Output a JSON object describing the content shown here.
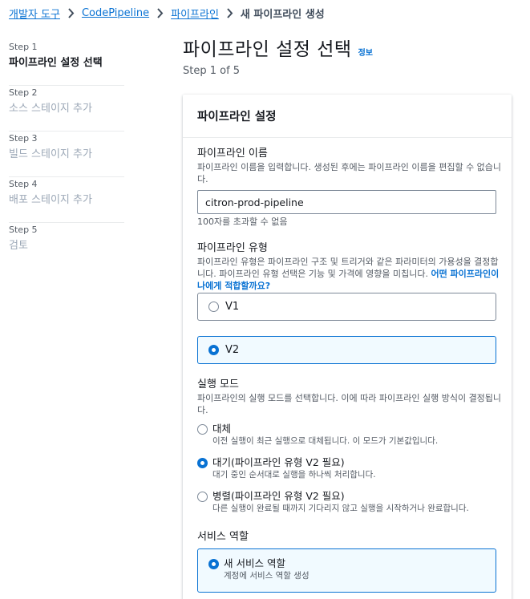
{
  "breadcrumb": {
    "items": [
      "개발자 도구",
      "CodePipeline",
      "파이프라인"
    ],
    "current": "새 파이프라인 생성"
  },
  "steps": [
    {
      "num": "Step 1",
      "name": "파이프라인 설정 선택",
      "active": true
    },
    {
      "num": "Step 2",
      "name": "소스 스테이지 추가",
      "active": false
    },
    {
      "num": "Step 3",
      "name": "빌드 스테이지 추가",
      "active": false
    },
    {
      "num": "Step 4",
      "name": "배포 스테이지 추가",
      "active": false
    },
    {
      "num": "Step 5",
      "name": "검토",
      "active": false
    }
  ],
  "page": {
    "title": "파이프라인 설정 선택",
    "info": "정보",
    "step_of": "Step 1 of 5"
  },
  "panel": {
    "header": "파이프라인 설정",
    "name_field": {
      "label": "파이프라인 이름",
      "desc": "파이프라인 이름을 입력합니다. 생성된 후에는 파이프라인 이름을 편집할 수 없습니다.",
      "value": "citron-prod-pipeline",
      "hint": "100자를 초과할 수 없음"
    },
    "type_field": {
      "label": "파이프라인 유형",
      "desc": "파이프라인 유형은 파이프라인 구조 및 트리거와 같은 파라미터의 가용성을 결정합니다. 파이프라인 유형 선택은 기능 및 가격에 영향을 미칩니다.",
      "link": "어떤 파이프라인이 나에게 적합할까요?",
      "options": [
        {
          "label": "V1",
          "selected": false
        },
        {
          "label": "V2",
          "selected": true
        }
      ]
    },
    "mode_field": {
      "label": "실행 모드",
      "desc": "파이프라인의 실행 모드를 선택합니다. 이에 따라 파이프라인 실행 방식이 결정됩니다.",
      "options": [
        {
          "title": "대체",
          "desc": "이전 실행이 최근 실행으로 대체됩니다. 이 모드가 기본값입니다.",
          "selected": false
        },
        {
          "title": "대기(파이프라인 유형 V2 필요)",
          "desc": "대기 중인 순서대로 실행을 하나씩 처리합니다.",
          "selected": true
        },
        {
          "title": "병렬(파이프라인 유형 V2 필요)",
          "desc": "다른 실행이 완료될 때까지 기다리지 않고 실행을 시작하거나 완료합니다.",
          "selected": false
        }
      ]
    },
    "role_field": {
      "label": "서비스 역할",
      "option_title": "새 서비스 역할",
      "option_desc": "계정에 서비스 역할 생성",
      "selected": true
    }
  }
}
